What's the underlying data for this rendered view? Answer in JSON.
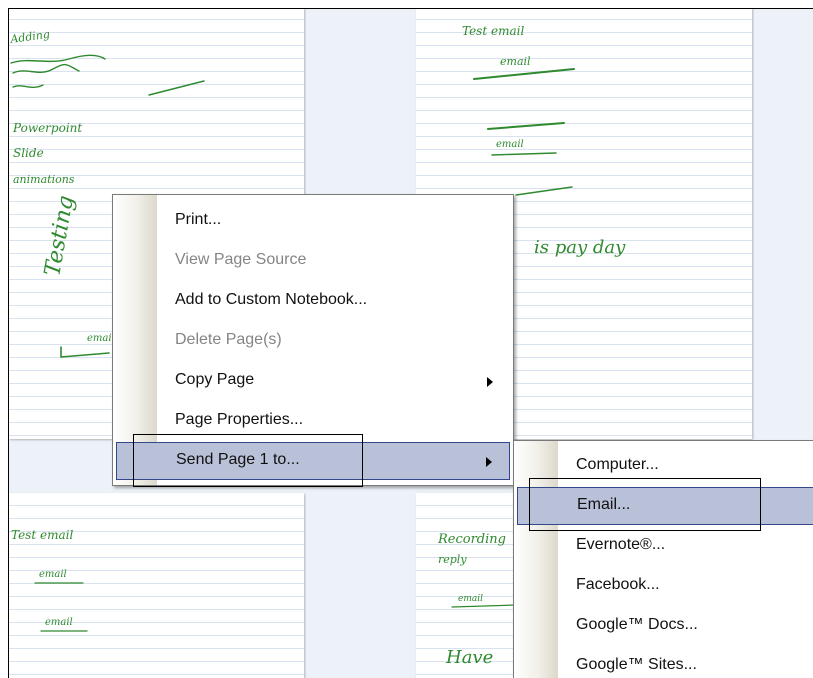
{
  "pages": {
    "page1": {
      "ink": [
        "Adding",
        "Powerpoint",
        "Slide",
        "animations",
        "Testing",
        "email"
      ]
    },
    "page2": {
      "ink": [
        "Test email",
        "email",
        "email",
        "is pay day"
      ]
    },
    "page3": {
      "ink": [
        "Test email",
        "email",
        "email"
      ]
    },
    "page4": {
      "ink": [
        "Recording",
        "reply",
        "email",
        "Have"
      ]
    }
  },
  "context_menu": {
    "items": [
      {
        "label": "Print...",
        "enabled": true
      },
      {
        "label": "View Page Source",
        "enabled": false
      },
      {
        "label": "Add to Custom Notebook...",
        "enabled": true
      },
      {
        "label": "Delete Page(s)",
        "enabled": false
      },
      {
        "label": "Copy Page",
        "enabled": true,
        "submenu": true
      },
      {
        "label": "Page Properties...",
        "enabled": true
      },
      {
        "label": "Send Page 1 to...",
        "enabled": true,
        "submenu": true,
        "highlighted": true
      }
    ]
  },
  "send_submenu": {
    "items": [
      {
        "label": "Computer..."
      },
      {
        "label": "Email...",
        "highlighted": true
      },
      {
        "label": "Evernote®..."
      },
      {
        "label": "Facebook..."
      },
      {
        "label": "Google™ Docs..."
      },
      {
        "label": "Google™ Sites..."
      }
    ]
  },
  "colors": {
    "ink": "#2f8a2f",
    "highlight": "#b9c1d8",
    "highlight_border": "#33488a",
    "background": "#edf2f9"
  }
}
